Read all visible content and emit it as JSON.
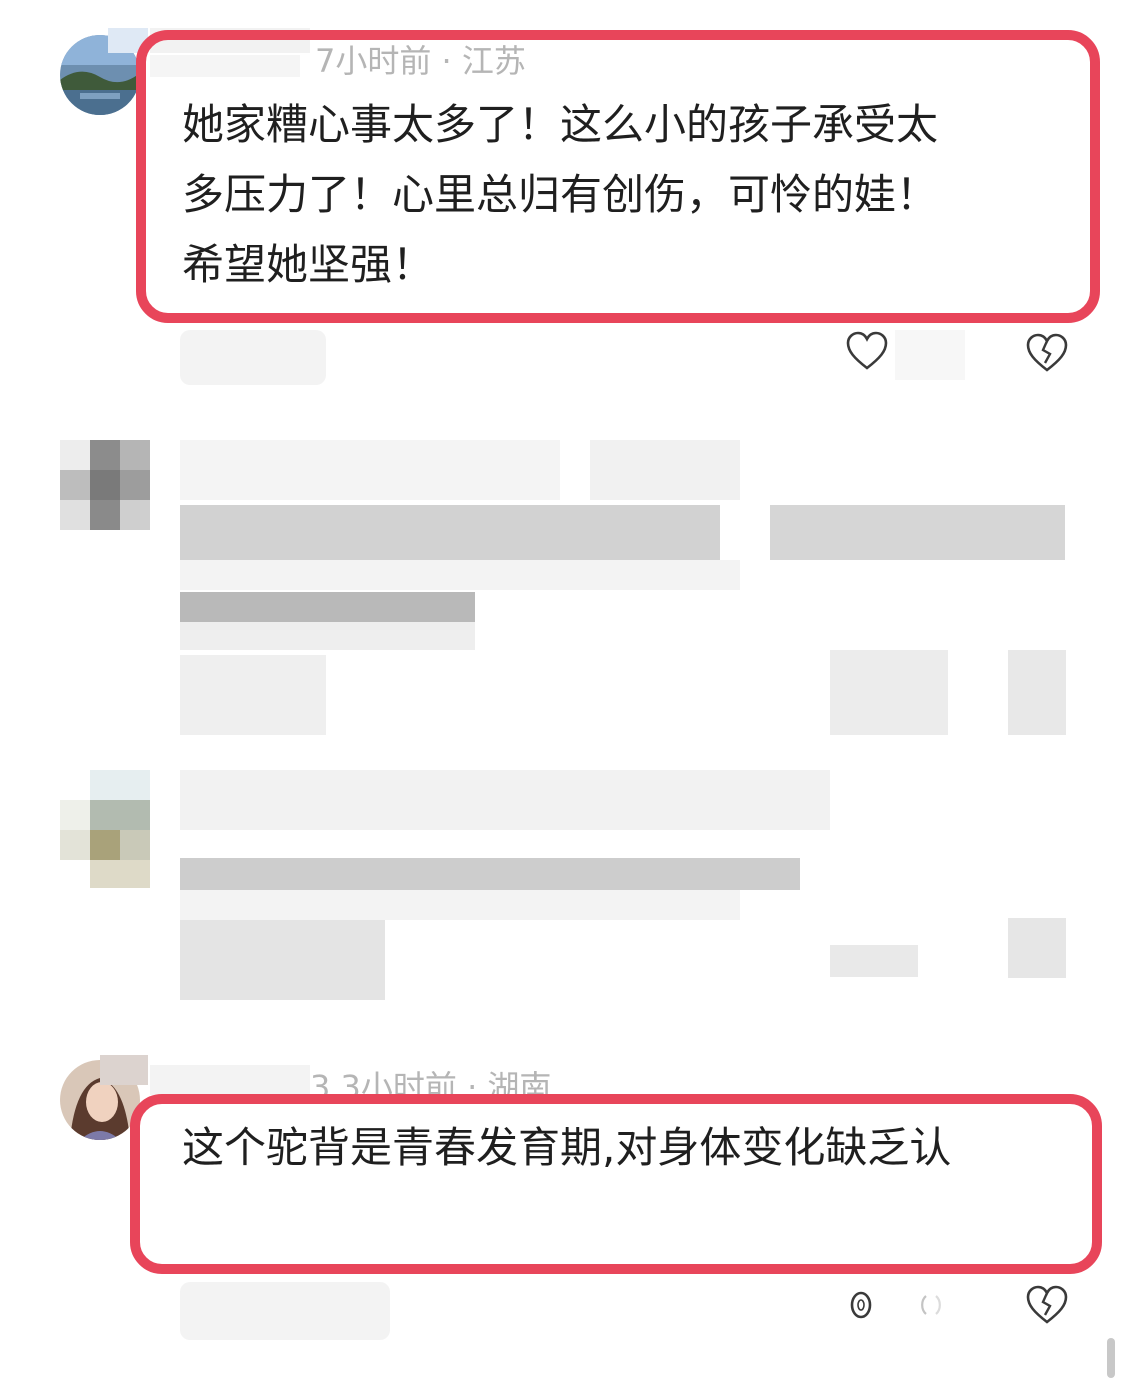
{
  "comments": [
    {
      "meta": "7小时前 · 江苏",
      "text_lines": [
        "她家糟心事太多了！这么小的孩子承受太",
        "多压力了！心里总归有创伤，可怜的娃！",
        "希望她坚强！"
      ]
    },
    {
      "meta": "3  3小时前 · 湖南",
      "text_lines": [
        "这个驼背是青春发育期,对身体变化缺乏认"
      ]
    }
  ],
  "icons": {
    "like": "heart-icon",
    "dislike": "broken-heart-icon",
    "loading": "spinner-icon"
  },
  "colors": {
    "highlight": "#e8455a",
    "meta_text": "#b5b5b5",
    "body_text": "#1f1f1f"
  }
}
